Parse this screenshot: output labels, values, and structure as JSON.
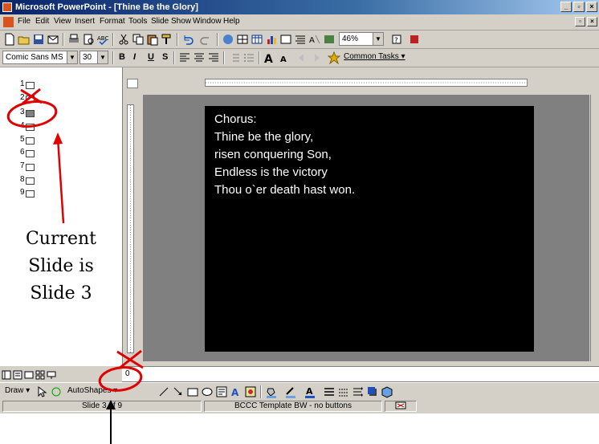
{
  "window": {
    "title": "Microsoft PowerPoint - [Thine Be the Glory]"
  },
  "menu": [
    "File",
    "Edit",
    "View",
    "Insert",
    "Format",
    "Tools",
    "Slide Show",
    "Window",
    "Help"
  ],
  "standard_toolbar": {
    "zoom": "46%"
  },
  "formatting_toolbar": {
    "font": "Comic Sans MS",
    "size": "30",
    "bold": "B",
    "italic": "I",
    "underline": "U",
    "shadow": "S",
    "common_tasks": "Common Tasks ▾"
  },
  "outline": {
    "slides": [
      "1",
      "2",
      "3",
      "4",
      "5",
      "6",
      "7",
      "8",
      "9"
    ],
    "current_index": 3
  },
  "slide": {
    "lines": [
      "Chorus:",
      "Thine be the glory,",
      "risen conquering Son,",
      "Endless is the victory",
      "Thou o`er death hast won."
    ]
  },
  "notes": {
    "text": "0"
  },
  "drawing_toolbar": {
    "draw": "Draw ▾",
    "autoshapes": "AutoShapes ▾"
  },
  "status": {
    "slide": "Slide 3 of 9",
    "template": "BCCC Template BW - no buttons"
  },
  "annotation": {
    "lines": [
      "Current",
      "Slide is",
      "Slide 3"
    ]
  },
  "colors": {
    "annotation_red": "#e00000",
    "slide_bg": "#000000",
    "slide_text": "#ffffff",
    "titlebar": "#0a246a"
  }
}
